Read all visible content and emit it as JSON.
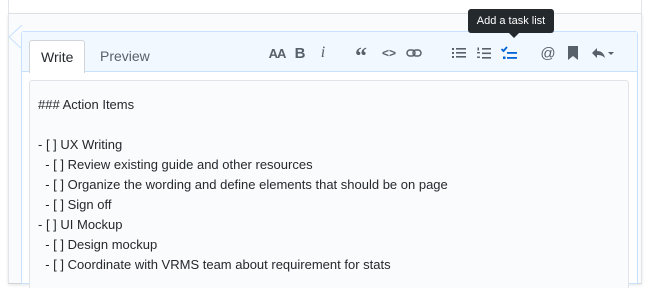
{
  "tabs": {
    "write": "Write",
    "preview": "Preview"
  },
  "toolbar": {
    "header_label": "AA",
    "bold_label": "B",
    "italic_label": "i",
    "quote_label": "“",
    "code_label": "<>",
    "active_color": "#0366d6",
    "icon_color": "#586069"
  },
  "tooltip": {
    "text": "Add a task list"
  },
  "editor": {
    "lines": [
      "### Action Items",
      "",
      "- [ ] UX Writing",
      "  - [ ] Review existing guide and other resources",
      "  - [ ] Organize the wording and define elements that should be on page",
      "  - [ ] Sign off",
      "- [ ] UI Mockup",
      "  - [ ] Design mockup",
      "  - [ ] Coordinate with VRMS team about requirement for stats"
    ]
  }
}
